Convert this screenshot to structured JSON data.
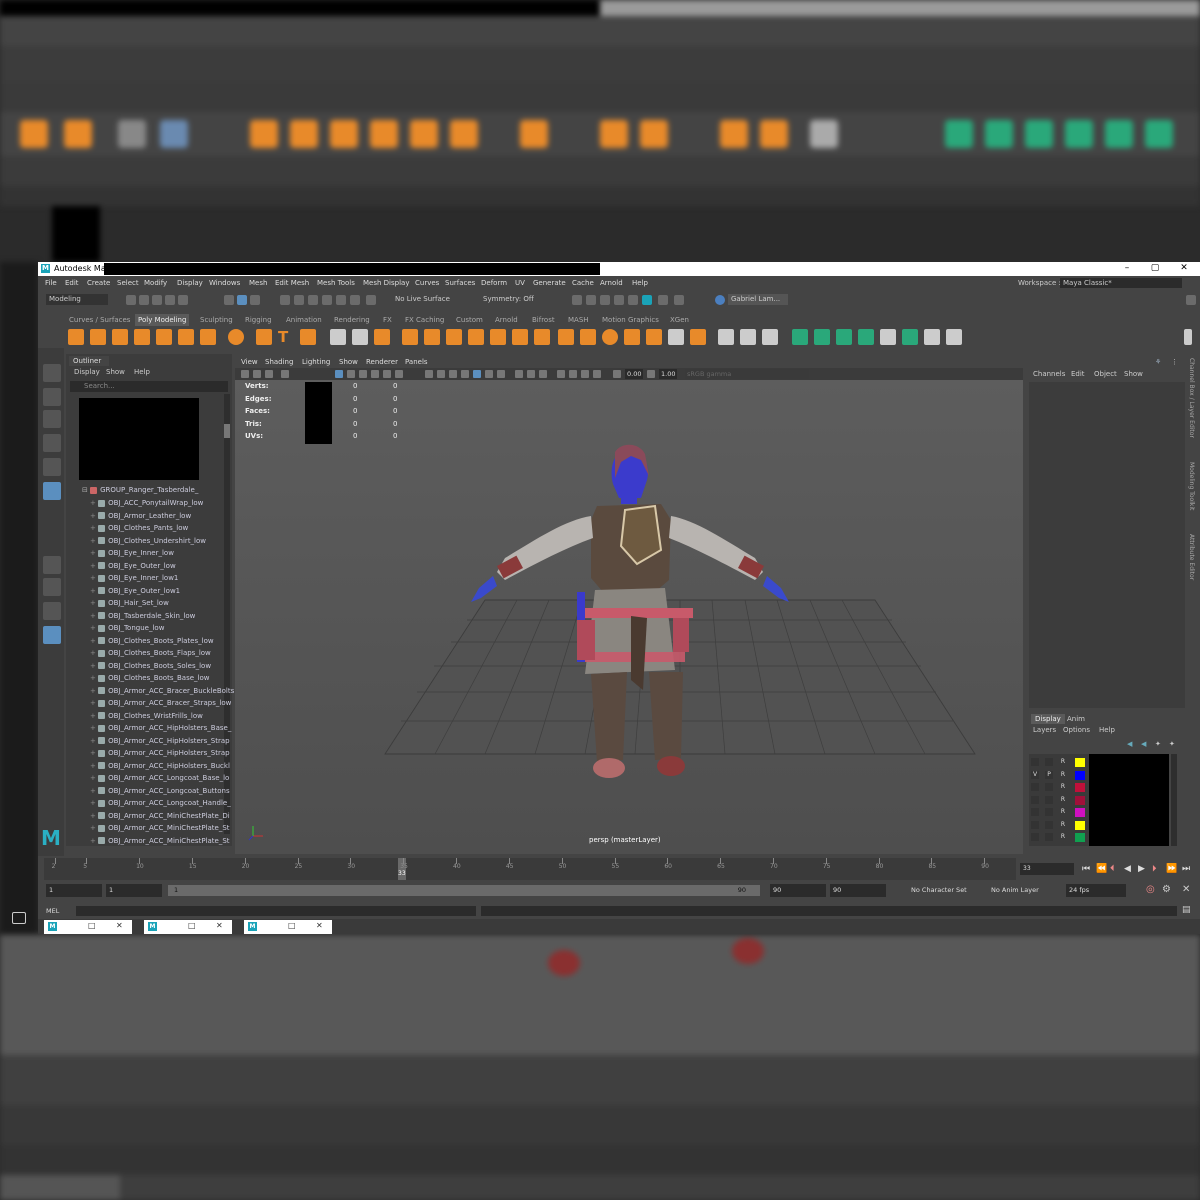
{
  "window": {
    "app_title": "Autodesk Maya",
    "workspace_label": "Workspace :",
    "workspace_value": "Maya Classic*"
  },
  "menubar": [
    "File",
    "Edit",
    "Create",
    "Select",
    "Modify",
    "Display",
    "Windows",
    "Mesh",
    "Edit Mesh",
    "Mesh Tools",
    "Mesh Display",
    "Curves",
    "Surfaces",
    "Deform",
    "UV",
    "Generate",
    "Cache",
    "Arnold",
    "Help"
  ],
  "statusline": {
    "mode": "Modeling",
    "live_surface": "No Live Surface",
    "symmetry": "Symmetry: Off",
    "user": "Gabriel Lam..."
  },
  "shelf_tabs": [
    "Curves / Surfaces",
    "Poly Modeling",
    "Sculpting",
    "Rigging",
    "Animation",
    "Rendering",
    "FX",
    "FX Caching",
    "Custom",
    "Arnold",
    "Bifrost",
    "MASH",
    "Motion Graphics",
    "XGen"
  ],
  "outliner": {
    "tab": "Outliner",
    "menu": [
      "Display",
      "Show",
      "Help"
    ],
    "search_placeholder": "Search...",
    "group": "GROUP_Ranger_Tasberdale_",
    "items": [
      "OBJ_ACC_PonytailWrap_low",
      "OBJ_Armor_Leather_low",
      "OBJ_Clothes_Pants_low",
      "OBJ_Clothes_Undershirt_low",
      "OBJ_Eye_Inner_low",
      "OBJ_Eye_Outer_low",
      "OBJ_Eye_Inner_low1",
      "OBJ_Eye_Outer_low1",
      "OBJ_Hair_Set_low",
      "OBJ_Tasberdale_Skin_low",
      "OBJ_Tongue_low",
      "OBJ_Clothes_Boots_Plates_low",
      "OBJ_Clothes_Boots_Flaps_low",
      "OBJ_Clothes_Boots_Soles_low",
      "OBJ_Clothes_Boots_Base_low",
      "OBJ_Armor_ACC_Bracer_BuckleBolts",
      "OBJ_Armor_ACC_Bracer_Straps_low",
      "OBJ_Clothes_WristFrills_low",
      "OBJ_Armor_ACC_HipHolsters_Base_",
      "OBJ_Armor_ACC_HipHolsters_Strap",
      "OBJ_Armor_ACC_HipHolsters_Strap",
      "OBJ_Armor_ACC_HipHolsters_Buckl",
      "OBJ_Armor_ACC_Longcoat_Base_lo",
      "OBJ_Armor_ACC_Longcoat_Buttons",
      "OBJ_Armor_ACC_Longcoat_Handle_",
      "OBJ_Armor_ACC_MiniChestPlate_Di",
      "OBJ_Armor_ACC_MiniChestPlate_St",
      "OBJ_Armor_ACC_MiniChestPlate_St"
    ]
  },
  "viewport": {
    "menu": [
      "View",
      "Shading",
      "Lighting",
      "Show",
      "Renderer",
      "Panels"
    ],
    "value_a": "0.00",
    "value_b": "1.00",
    "color_space": "sRGB gamma",
    "hud": [
      {
        "label": "Verts:",
        "a": "0",
        "b": "0"
      },
      {
        "label": "Edges:",
        "a": "0",
        "b": "0"
      },
      {
        "label": "Faces:",
        "a": "0",
        "b": "0"
      },
      {
        "label": "Tris:",
        "a": "0",
        "b": "0"
      },
      {
        "label": "UVs:",
        "a": "0",
        "b": "0"
      }
    ],
    "camera_label": "persp (masterLayer)"
  },
  "channelbox": {
    "menu": [
      "Channels",
      "Edit",
      "Object",
      "Show"
    ],
    "side_tabs": [
      "Channel Box / Layer Editor",
      "Modeling Toolkit",
      "Attribute Editor"
    ]
  },
  "layers": {
    "tabs": [
      "Display",
      "Anim"
    ],
    "menu": [
      "Layers",
      "Options",
      "Help"
    ],
    "rows": [
      {
        "v": "",
        "p": "",
        "r": "R",
        "color": "#ffff00"
      },
      {
        "v": "V",
        "p": "P",
        "r": "R",
        "color": "#0000ff"
      },
      {
        "v": "",
        "p": "",
        "r": "R",
        "color": "#c0103a"
      },
      {
        "v": "",
        "p": "",
        "r": "R",
        "color": "#a0103a"
      },
      {
        "v": "",
        "p": "",
        "r": "R",
        "color": "#d010c0"
      },
      {
        "v": "",
        "p": "",
        "r": "R",
        "color": "#ffff00"
      },
      {
        "v": "",
        "p": "",
        "r": "R",
        "color": "#10a050"
      }
    ]
  },
  "timeline": {
    "ticks": [
      "2",
      "5",
      "10",
      "15",
      "20",
      "25",
      "30",
      "35",
      "40",
      "45",
      "50",
      "55",
      "60",
      "65",
      "70",
      "75",
      "80",
      "85",
      "90"
    ],
    "current_frame": "33",
    "frame_field": "33"
  },
  "range": {
    "start": "1",
    "start2": "1",
    "slider_start": "1",
    "slider_end": "90",
    "end": "90",
    "end2": "90",
    "character_set": "No Character Set",
    "anim_layer": "No Anim Layer",
    "fps": "24 fps"
  },
  "cmdline": {
    "mel": "MEL"
  },
  "colors": {
    "maya_teal": "#1aa3b8",
    "shelf_orange": "#e88a2a",
    "shelf_green": "#2aa87a",
    "selection_blue": "#5b8fbf"
  }
}
